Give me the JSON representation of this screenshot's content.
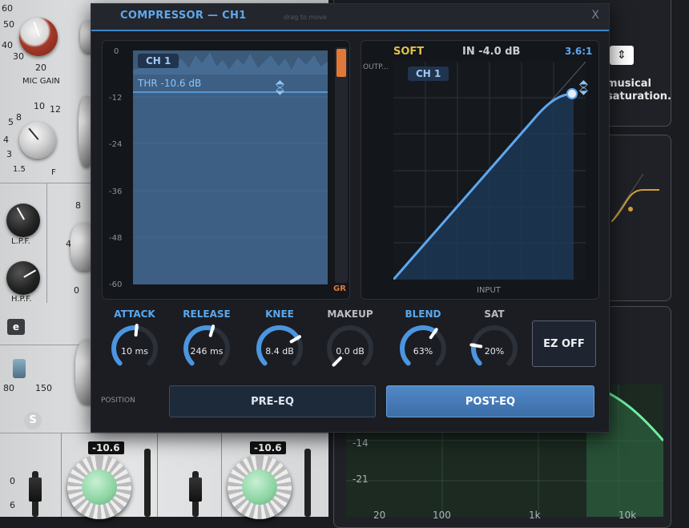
{
  "window": {
    "title": "COMPRESSOR — CH1",
    "drag_hint": "drag to move",
    "close_label": "X"
  },
  "meter": {
    "channel": "CH 1",
    "threshold_label": "THR -10.6 dB",
    "y_ticks": [
      "0",
      "-12",
      "-24",
      "-36",
      "-48",
      "-60"
    ],
    "gr_label": "GR",
    "gr_level": 0.12,
    "colors": {
      "line": "#5ea8ee",
      "gr": "#e0783a"
    }
  },
  "curve": {
    "knee_type": "SOFT",
    "input_level": "IN -4.0 dB",
    "ratio": "3.6:1",
    "channel": "CH 1",
    "y_label": "OUTP...",
    "x_label": "INPUT"
  },
  "knobs": [
    {
      "label": "ATTACK",
      "value": "10 ms",
      "level": 0.52
    },
    {
      "label": "RELEASE",
      "value": "246 ms",
      "level": 0.56
    },
    {
      "label": "KNEE",
      "value": "8.4 dB",
      "level": 0.72
    },
    {
      "label": "MAKEUP",
      "value": "0.0 dB",
      "level": 0.0
    },
    {
      "label": "BLEND",
      "value": "63%",
      "level": 0.63
    },
    {
      "label": "SAT",
      "value": "20%",
      "level": 0.2
    }
  ],
  "ez_button": {
    "label": "EZ OFF"
  },
  "position": {
    "label": "POSITION",
    "options": [
      "PRE-EQ",
      "POST-EQ"
    ],
    "selected": "POST-EQ"
  },
  "background": {
    "mic_gain_label": "MIC GAIN",
    "mic_ticks": [
      "60",
      "50",
      "40",
      "30",
      "20"
    ],
    "freq_ticks": [
      "8",
      "10",
      "12",
      "5",
      "4",
      "3",
      "1.5"
    ],
    "freq_unit": "F",
    "lpf_label": "L.P.F.",
    "hpf_label": "H.P.F.",
    "e_button": "e",
    "hpf_range": [
      "80",
      "150"
    ],
    "fader_ticks_left": [
      "0",
      "6"
    ],
    "channel_values": [
      "-10.6",
      "-10.6"
    ],
    "side_text": [
      "musical",
      "saturation."
    ],
    "eq_db_ticks": [
      "-14",
      "-21"
    ],
    "eq_freq_ticks": [
      "20",
      "100",
      "1k",
      "10k"
    ]
  }
}
